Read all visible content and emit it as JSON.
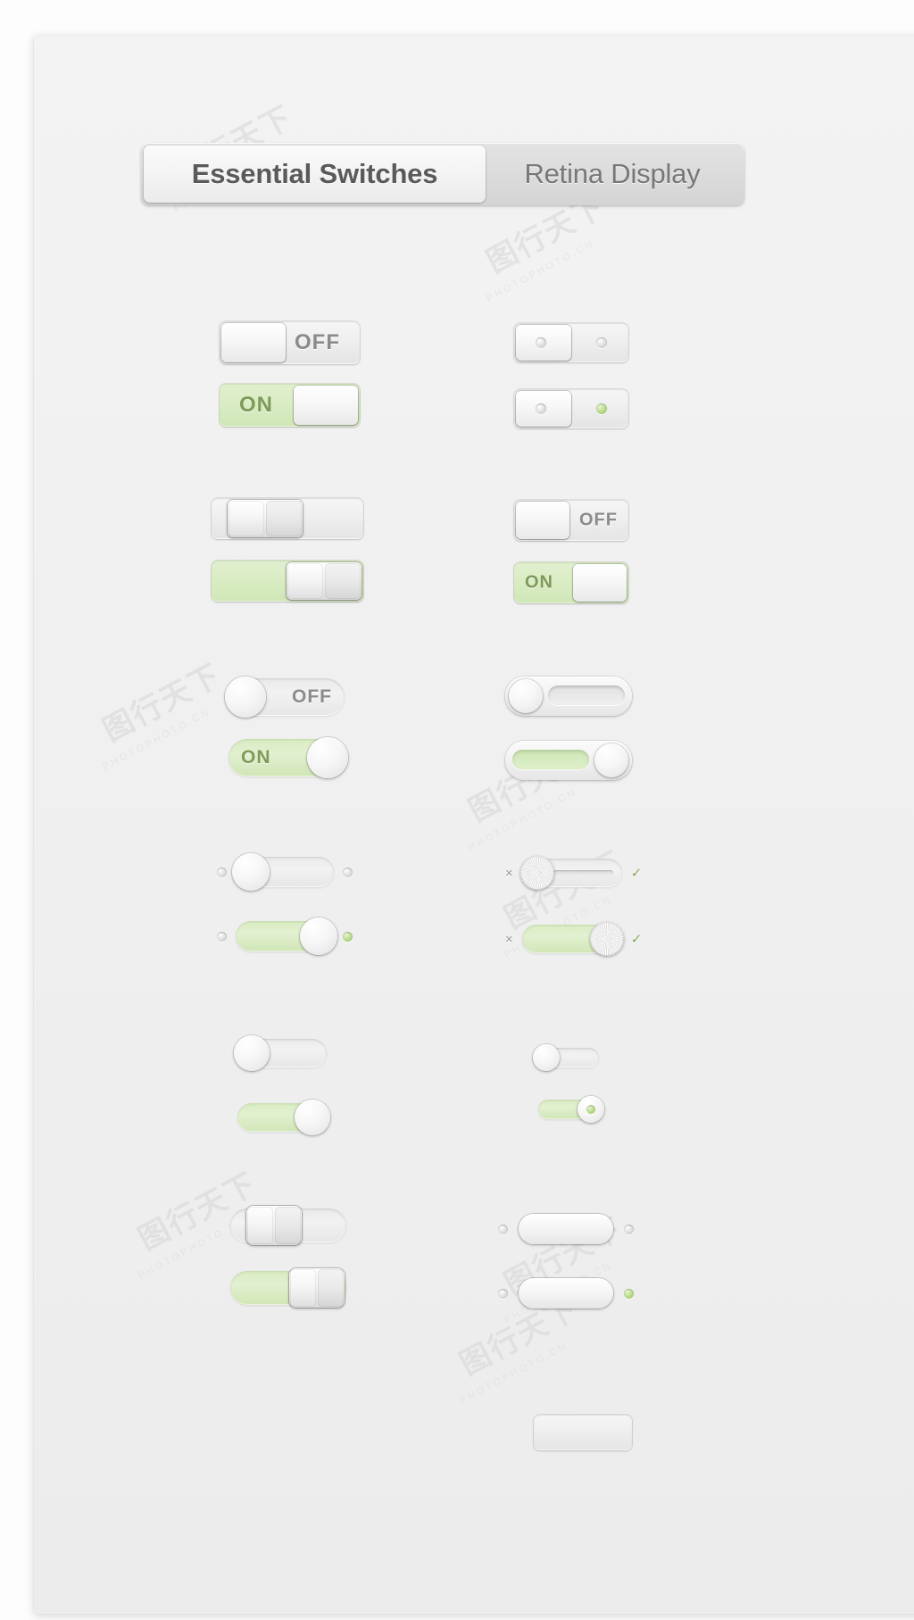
{
  "page": {
    "background_color": "#fdfdfd",
    "card_color": "#f1f1f1"
  },
  "tabs": {
    "items": [
      {
        "label": "Essential Switches",
        "active": true
      },
      {
        "label": "Retina Display",
        "active": false
      }
    ]
  },
  "labels": {
    "off": "OFF",
    "on": "ON",
    "cross": "×",
    "check": "✓"
  },
  "colors": {
    "track_off": "#ededed",
    "track_on": "#d9ecc3",
    "text_off": "#8b8b8b",
    "text_on": "#7d9a59",
    "led_on": "#8fba5a",
    "tab_active_text": "#5a5a5a",
    "tab_inactive_text": "#777777"
  },
  "watermarks": [
    {
      "mark": "图行天下",
      "text": "PHOTOPHOTO.CN"
    }
  ],
  "switches": [
    {
      "group": 1,
      "column": "left",
      "style": "rounded-rect-label",
      "state": "off",
      "label": "OFF",
      "knob_side": "left"
    },
    {
      "group": 1,
      "column": "left",
      "style": "rounded-rect-label",
      "state": "on",
      "label": "ON",
      "knob_side": "right"
    },
    {
      "group": 1,
      "column": "right",
      "style": "rounded-rect-dots",
      "state": "off",
      "label": "",
      "knob_side": "left",
      "dot_left": "gray",
      "dot_right": "gray"
    },
    {
      "group": 1,
      "column": "right",
      "style": "rounded-rect-dots",
      "state": "on",
      "label": "",
      "knob_side": "left",
      "dot_left": "gray",
      "dot_right": "green"
    },
    {
      "group": 2,
      "column": "left",
      "style": "rounded-rect-split-knob",
      "state": "off",
      "label": "",
      "knob_side": "left"
    },
    {
      "group": 2,
      "column": "left",
      "style": "rounded-rect-split-knob",
      "state": "on",
      "label": "",
      "knob_side": "right"
    },
    {
      "group": 2,
      "column": "right",
      "style": "rounded-rect-label-square",
      "state": "off",
      "label": "OFF",
      "knob_side": "left"
    },
    {
      "group": 2,
      "column": "right",
      "style": "rounded-rect-label-square",
      "state": "on",
      "label": "ON",
      "knob_side": "right"
    },
    {
      "group": 3,
      "column": "left",
      "style": "pill-label",
      "state": "off",
      "label": "OFF",
      "knob_side": "left"
    },
    {
      "group": 3,
      "column": "left",
      "style": "pill-label",
      "state": "on",
      "label": "ON",
      "knob_side": "right"
    },
    {
      "group": 3,
      "column": "right",
      "style": "pill-recessed",
      "state": "off",
      "label": "",
      "knob_side": "left"
    },
    {
      "group": 3,
      "column": "right",
      "style": "pill-recessed",
      "state": "on",
      "label": "",
      "knob_side": "right"
    },
    {
      "group": 4,
      "column": "left",
      "style": "pill-dots-outside",
      "state": "off",
      "label": "",
      "knob_side": "left",
      "dot_left": "gray",
      "dot_right": "gray"
    },
    {
      "group": 4,
      "column": "left",
      "style": "pill-dots-outside",
      "state": "on",
      "label": "",
      "knob_side": "right",
      "dot_left": "gray",
      "dot_right": "green"
    },
    {
      "group": 4,
      "column": "right",
      "style": "slider-metal-knob",
      "state": "off",
      "label": "",
      "knob_side": "left",
      "mark_left": "×",
      "mark_right": "✓"
    },
    {
      "group": 4,
      "column": "right",
      "style": "slider-metal-knob",
      "state": "on",
      "label": "",
      "knob_side": "right",
      "mark_left": "×",
      "mark_right": "✓"
    },
    {
      "group": 5,
      "column": "left",
      "style": "pill-plain",
      "state": "off",
      "label": "",
      "knob_side": "left"
    },
    {
      "group": 5,
      "column": "left",
      "style": "pill-plain",
      "state": "on",
      "label": "",
      "knob_side": "right"
    },
    {
      "group": 5,
      "column": "right",
      "style": "pill-small",
      "state": "off",
      "label": "",
      "knob_side": "left"
    },
    {
      "group": 5,
      "column": "right",
      "style": "pill-small",
      "state": "on",
      "label": "",
      "knob_side": "right"
    },
    {
      "group": 6,
      "column": "left",
      "style": "pill-split-knob",
      "state": "off",
      "label": "",
      "knob_side": "left"
    },
    {
      "group": 6,
      "column": "left",
      "style": "pill-split-knob",
      "state": "on",
      "label": "",
      "knob_side": "right"
    },
    {
      "group": 6,
      "column": "right",
      "style": "pill-outline-dots",
      "state": "off",
      "label": "",
      "knob_side": "center",
      "dot_left": "gray",
      "dot_right": "gray"
    },
    {
      "group": 6,
      "column": "right",
      "style": "pill-outline-dots",
      "state": "on",
      "label": "",
      "knob_side": "center",
      "dot_left": "gray",
      "dot_right": "green"
    }
  ]
}
